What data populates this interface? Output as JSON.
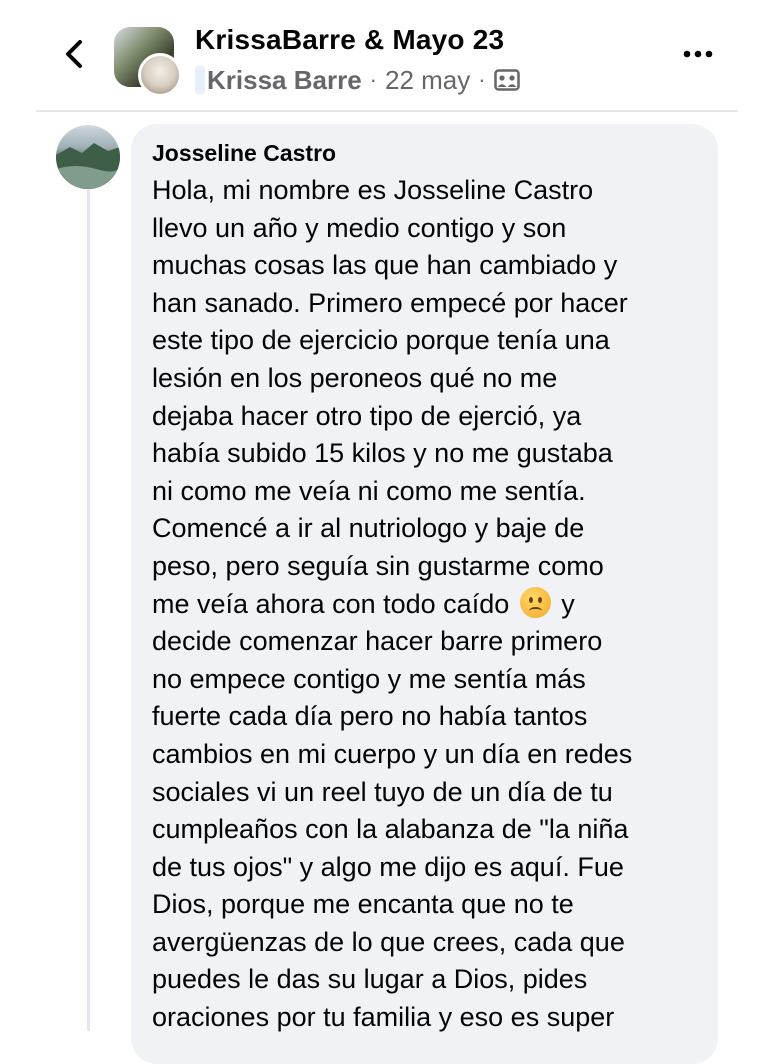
{
  "header": {
    "group_title": "KrissaBarre & Mayo 23",
    "author": "Krissa Barre",
    "separator": "·",
    "date": "22 may",
    "back_icon": "chevron-left-icon",
    "more_icon": "more-horizontal-icon",
    "privacy_icon": "group-members-icon"
  },
  "comment": {
    "author": "Josseline Castro",
    "lines": [
      "Hola, mi nombre es Josseline Castro",
      "llevo un año y medio contigo y son",
      "muchas cosas las que han cambiado y",
      "han sanado. Primero empecé por hacer",
      "este tipo de ejercicio porque tenía una",
      "lesión en los peroneos qué no me",
      "dejaba hacer otro tipo de ejerció, ya",
      "había subido 15 kilos y no me gustaba",
      "ni como me veía ni como me sentía.",
      "Comencé a ir al nutriologo y baje de",
      "peso, pero seguía sin gustarme como"
    ],
    "emoji_line_before": "me veía ahora con todo caído",
    "emoji_name": "worried-face-emoji",
    "emoji_line_after": "y",
    "lines_after": [
      "decide comenzar hacer barre primero",
      "no empece contigo y me sentía más",
      "fuerte cada día pero no había tantos",
      "cambios en mi cuerpo y un día en redes",
      "sociales vi un reel tuyo de un día de tu",
      "cumpleaños con la alabanza de \"la niña",
      "de tus ojos\" y algo me dijo es aquí. Fue",
      "Dios, porque me encanta que no te",
      "avergüenzas de lo que crees, cada que",
      "puedes le das su lugar a Dios, pides",
      "oraciones por tu familia y eso es super"
    ]
  }
}
